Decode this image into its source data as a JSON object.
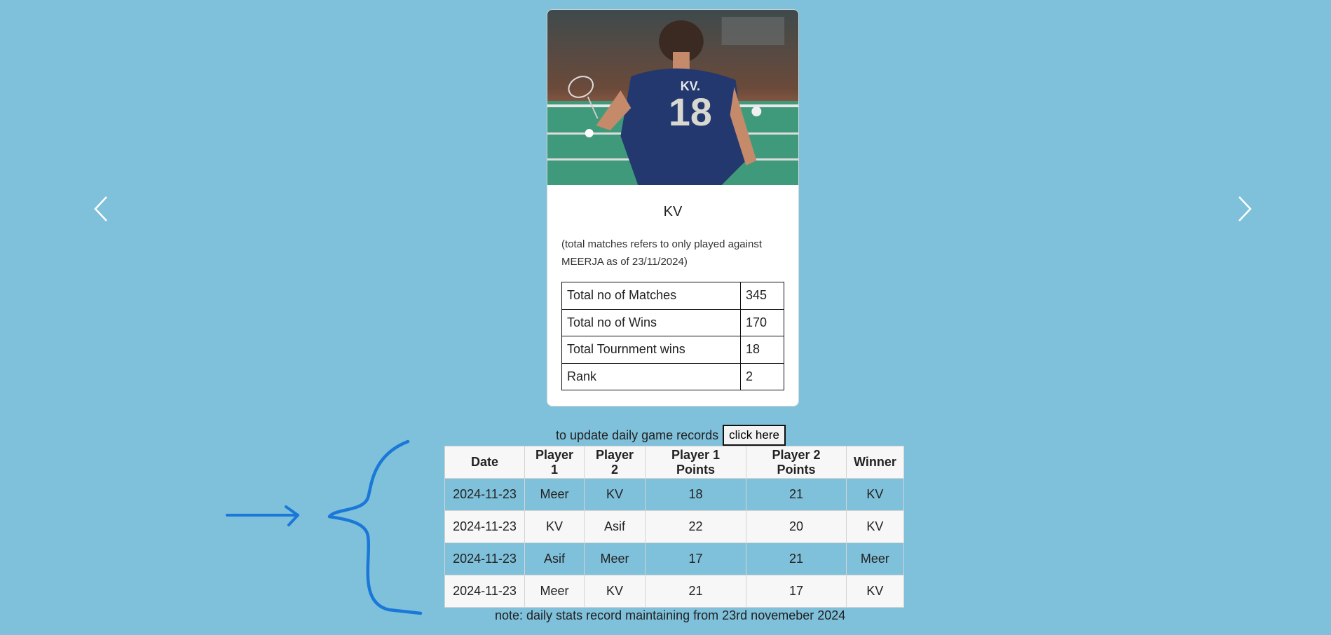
{
  "carousel": {
    "prev_icon": "chevron-left-icon",
    "next_icon": "chevron-right-icon"
  },
  "card": {
    "image_icon": "badminton-player-photo",
    "jersey_text": "KV.",
    "jersey_number": "18",
    "name": "KV",
    "note": "(total matches refers to only played against MEERJA as of 23/11/2024)",
    "stats": [
      {
        "label": "Total no of Matches",
        "value": "345"
      },
      {
        "label": "Total no of Wins",
        "value": "170"
      },
      {
        "label": "Total Tournment wins",
        "value": "18"
      },
      {
        "label": "Rank",
        "value": "2"
      }
    ]
  },
  "update": {
    "text": "to update daily game records",
    "button_label": "click here"
  },
  "records": {
    "headers": [
      "Date",
      "Player 1",
      "Player 2",
      "Player 1 Points",
      "Player 2 Points",
      "Winner"
    ],
    "rows": [
      [
        "2024-11-23",
        "Meer",
        "KV",
        "18",
        "21",
        "KV"
      ],
      [
        "2024-11-23",
        "KV",
        "Asif",
        "22",
        "20",
        "KV"
      ],
      [
        "2024-11-23",
        "Asif",
        "Meer",
        "17",
        "21",
        "Meer"
      ],
      [
        "2024-11-23",
        "Meer",
        "KV",
        "21",
        "17",
        "KV"
      ]
    ]
  },
  "footer_note": "note: daily stats record maintaining from 23rd novemeber 2024",
  "colors": {
    "background": "#7fc0da",
    "annotation": "#1a78d8"
  }
}
